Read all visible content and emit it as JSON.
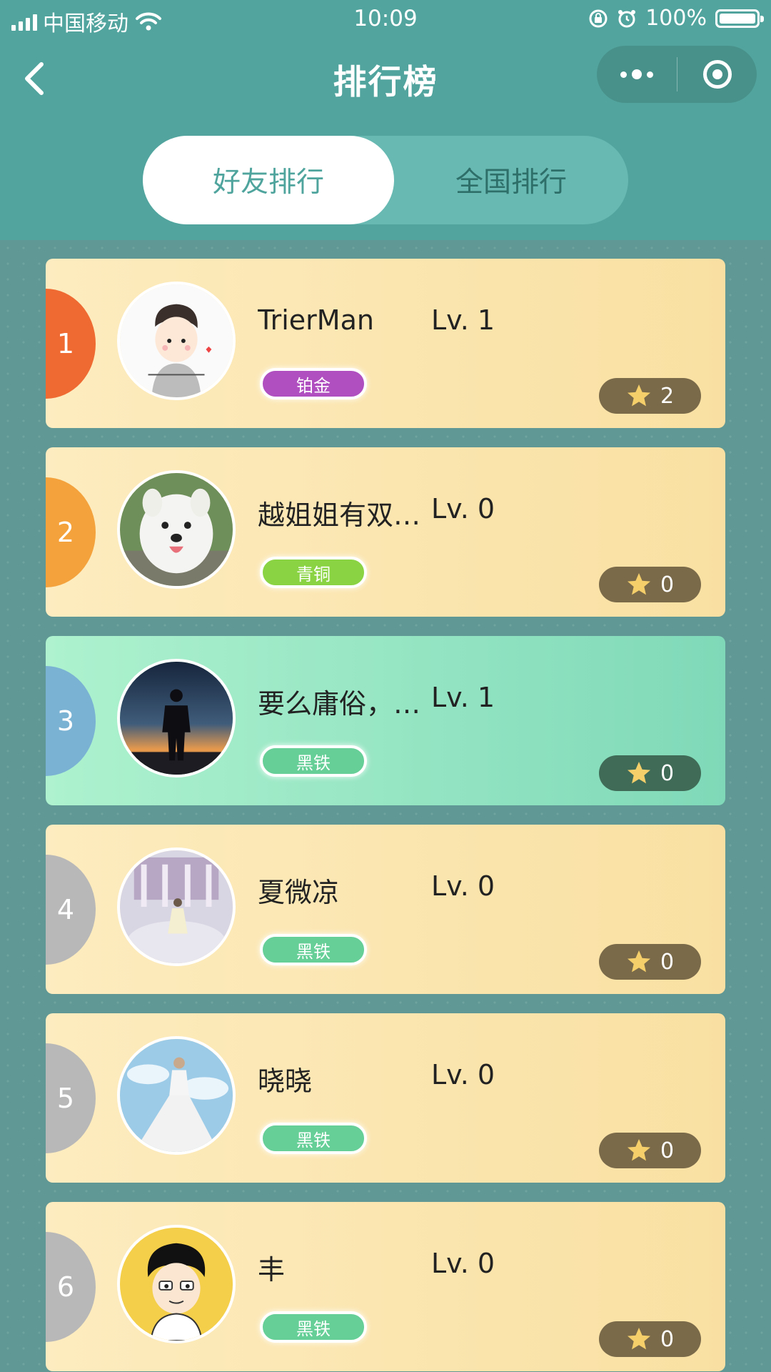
{
  "status_bar": {
    "carrier": "中国移动",
    "time": "10:09",
    "battery": "100%",
    "icons": [
      "signal-icon",
      "wifi-icon",
      "rotation-lock-icon",
      "alarm-icon",
      "battery-icon"
    ]
  },
  "nav": {
    "title": "排行榜",
    "icons": [
      "back-icon",
      "more-icon",
      "close-target-icon"
    ]
  },
  "tabs": [
    {
      "label": "好友排行",
      "active": true
    },
    {
      "label": "全国排行",
      "active": false
    }
  ],
  "colors": {
    "header": "#52a59e",
    "rank_1": "#ef6a32",
    "rank_2": "#f4a23c",
    "rank_3": "#7ab2d4",
    "rank_other": "#b8b8b8",
    "badge_platinum": "#b04fc0",
    "badge_bronze": "#8ad444",
    "badge_iron": "#66cf98",
    "star_pill": "#7a6a4a",
    "star_pill_highlight": "#3f6b57"
  },
  "ranking": [
    {
      "rank": "1",
      "name": "TrierMan",
      "level": "Lv. 1",
      "badge": "铂金",
      "badge_color": "#b04fc0",
      "stars": "2",
      "rank_color": "#ef6a32",
      "highlight": false
    },
    {
      "rank": "2",
      "name": "越姐姐有双眼皮，好美",
      "level": "Lv. 0",
      "badge": "青铜",
      "badge_color": "#8ad444",
      "stars": "0",
      "rank_color": "#f4a23c",
      "highlight": false
    },
    {
      "rank": "3",
      "name": "要么庸俗，要么孤独",
      "level": "Lv. 1",
      "badge": "黑铁",
      "badge_color": "#66cf98",
      "stars": "0",
      "rank_color": "#7ab2d4",
      "highlight": true
    },
    {
      "rank": "4",
      "name": "夏微凉",
      "level": "Lv. 0",
      "badge": "黑铁",
      "badge_color": "#66cf98",
      "stars": "0",
      "rank_color": "#b8b8b8",
      "highlight": false
    },
    {
      "rank": "5",
      "name": "晓晓",
      "level": "Lv. 0",
      "badge": "黑铁",
      "badge_color": "#66cf98",
      "stars": "0",
      "rank_color": "#b8b8b8",
      "highlight": false
    },
    {
      "rank": "6",
      "name": "丰",
      "level": "Lv. 0",
      "badge": "黑铁",
      "badge_color": "#66cf98",
      "stars": "0",
      "rank_color": "#b8b8b8",
      "highlight": false
    }
  ]
}
